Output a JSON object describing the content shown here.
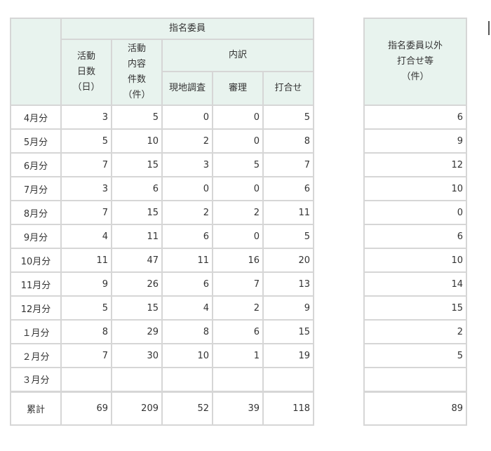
{
  "main_table": {
    "group_header": "指名委員",
    "col_days_lines": [
      "活動",
      "日数",
      "（日）"
    ],
    "col_items_lines": [
      "活動",
      "内容",
      "件数",
      "（件）"
    ],
    "breakdown_header": "内訳",
    "sub_headers": [
      "現地調査",
      "審理",
      "打合せ"
    ],
    "rows": [
      {
        "month": "4月分",
        "days": "3",
        "items": "5",
        "survey": "0",
        "review": "0",
        "meeting": "5"
      },
      {
        "month": "5月分",
        "days": "5",
        "items": "10",
        "survey": "2",
        "review": "0",
        "meeting": "8"
      },
      {
        "month": "6月分",
        "days": "7",
        "items": "15",
        "survey": "3",
        "review": "5",
        "meeting": "7"
      },
      {
        "month": "7月分",
        "days": "3",
        "items": "6",
        "survey": "0",
        "review": "0",
        "meeting": "6"
      },
      {
        "month": "8月分",
        "days": "7",
        "items": "15",
        "survey": "2",
        "review": "2",
        "meeting": "11"
      },
      {
        "month": "9月分",
        "days": "4",
        "items": "11",
        "survey": "6",
        "review": "0",
        "meeting": "5"
      },
      {
        "month": "10月分",
        "days": "11",
        "items": "47",
        "survey": "11",
        "review": "16",
        "meeting": "20"
      },
      {
        "month": "11月分",
        "days": "9",
        "items": "26",
        "survey": "6",
        "review": "7",
        "meeting": "13"
      },
      {
        "month": "12月分",
        "days": "5",
        "items": "15",
        "survey": "4",
        "review": "2",
        "meeting": "9"
      },
      {
        "month": "１月分",
        "days": "8",
        "items": "29",
        "survey": "8",
        "review": "6",
        "meeting": "15"
      },
      {
        "month": "２月分",
        "days": "7",
        "items": "30",
        "survey": "10",
        "review": "1",
        "meeting": "19"
      },
      {
        "month": "３月分",
        "days": "",
        "items": "",
        "survey": "",
        "review": "",
        "meeting": ""
      }
    ],
    "total": {
      "label": "累計",
      "days": "69",
      "items": "209",
      "survey": "52",
      "review": "39",
      "meeting": "118"
    }
  },
  "side_table": {
    "header_lines": [
      "指名委員以外",
      "打合せ等",
      "（件）"
    ],
    "values": [
      "6",
      "9",
      "12",
      "10",
      "0",
      "6",
      "10",
      "14",
      "15",
      "2",
      "5",
      ""
    ],
    "total": "89"
  }
}
